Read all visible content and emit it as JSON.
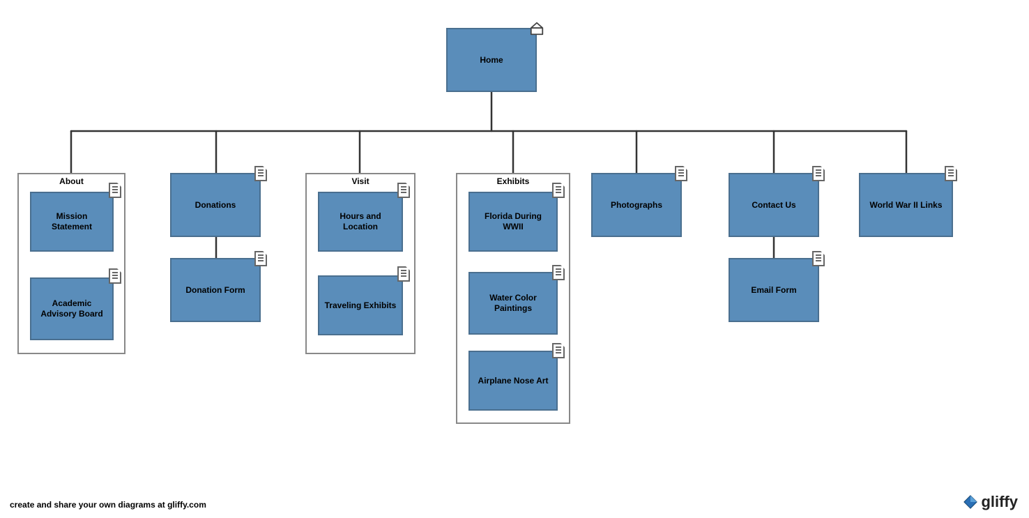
{
  "diagram": {
    "root": {
      "label": "Home"
    },
    "branches": [
      {
        "type": "group",
        "title": "About",
        "children": [
          {
            "label": "Mission Statement"
          },
          {
            "label": "Academic Advisory Board"
          }
        ]
      },
      {
        "type": "parent_with_child",
        "parent_label": "Donations",
        "child_label": "Donation Form"
      },
      {
        "type": "group",
        "title": "Visit",
        "children": [
          {
            "label": "Hours and Location"
          },
          {
            "label": "Traveling Exhibits"
          }
        ]
      },
      {
        "type": "group",
        "title": "Exhibits",
        "children": [
          {
            "label": "Florida During WWII"
          },
          {
            "label": "Water Color Paintings"
          },
          {
            "label": "Airplane Nose Art"
          }
        ]
      },
      {
        "type": "leaf",
        "label": "Photographs"
      },
      {
        "type": "parent_with_child",
        "parent_label": "Contact Us",
        "child_label": "Email Form"
      },
      {
        "type": "leaf",
        "label": "World War II Links"
      }
    ]
  },
  "footer": {
    "tagline": "create and share your own diagrams at gliffy.com",
    "brand": "gliffy"
  },
  "colors": {
    "node_fill": "#5a8dba",
    "node_border": "#4a6f8f",
    "container_border": "#888888",
    "connector": "#333333"
  }
}
